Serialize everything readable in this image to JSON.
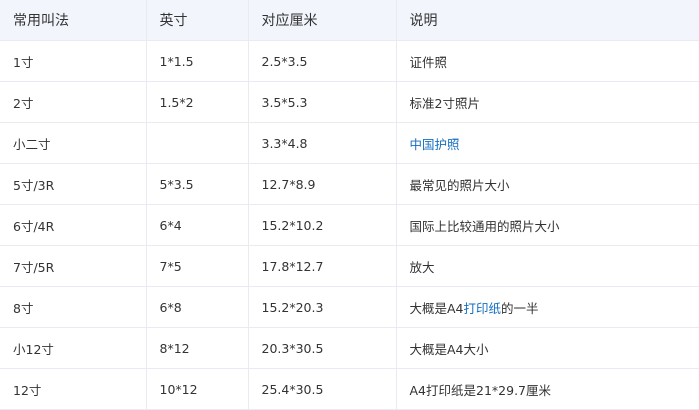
{
  "table": {
    "headers": [
      "常用叫法",
      "英寸",
      "对应厘米",
      "说明"
    ],
    "rows": [
      {
        "name": "1寸",
        "inch": "1*1.5",
        "cm": "2.5*3.5",
        "desc": [
          {
            "text": "证件照"
          }
        ]
      },
      {
        "name": "2寸",
        "inch": "1.5*2",
        "cm": "3.5*5.3",
        "desc": [
          {
            "text": "标准2寸照片"
          }
        ]
      },
      {
        "name": "小二寸",
        "inch": "",
        "cm": "3.3*4.8",
        "desc": [
          {
            "text": "中国护照",
            "link": true
          }
        ]
      },
      {
        "name": "5寸/3R",
        "inch": "5*3.5",
        "cm": "12.7*8.9",
        "desc": [
          {
            "text": "最常见的照片大小"
          }
        ]
      },
      {
        "name": "6寸/4R",
        "inch": "6*4",
        "cm": "15.2*10.2",
        "desc": [
          {
            "text": "国际上比较通用的照片大小"
          }
        ]
      },
      {
        "name": "7寸/5R",
        "inch": "7*5",
        "cm": "17.8*12.7",
        "desc": [
          {
            "text": "放大"
          }
        ]
      },
      {
        "name": "8寸",
        "inch": "6*8",
        "cm": "15.2*20.3",
        "desc": [
          {
            "text": "大概是A4"
          },
          {
            "text": "打印纸",
            "link": true
          },
          {
            "text": "的一半"
          }
        ]
      },
      {
        "name": "小12寸",
        "inch": "8*12",
        "cm": "20.3*30.5",
        "desc": [
          {
            "text": "大概是A4大小"
          }
        ]
      },
      {
        "name": "12寸",
        "inch": "10*12",
        "cm": "25.4*30.5",
        "desc": [
          {
            "text": "A4打印纸是21*29.7厘米"
          }
        ]
      }
    ]
  },
  "colors": {
    "header_bg": "#f2f6fc",
    "border": "#e8ecf2",
    "text": "#333333",
    "link": "#136ec2"
  }
}
